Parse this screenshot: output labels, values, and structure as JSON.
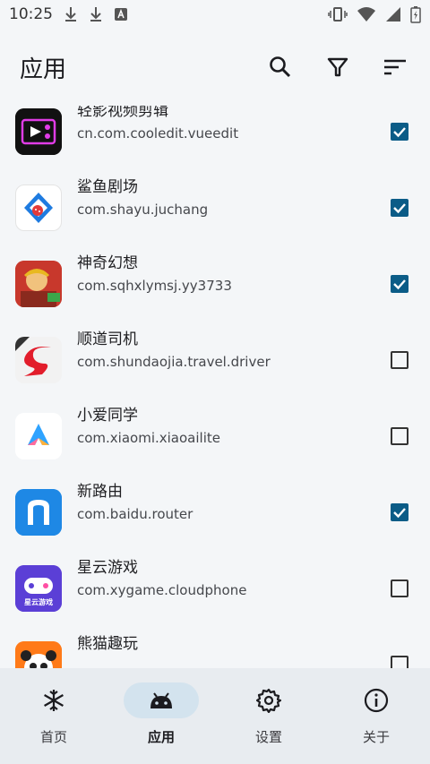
{
  "status": {
    "time": "10:25"
  },
  "appbar": {
    "title": "应用",
    "search_icon": "search-icon",
    "filter_icon": "filter-icon",
    "sort_icon": "sort-icon"
  },
  "apps": [
    {
      "name": "轻影视频剪辑",
      "package": "cn.com.cooledit.vueedit",
      "checked": true
    },
    {
      "name": "鲨鱼剧场",
      "package": "com.shayu.juchang",
      "checked": true
    },
    {
      "name": "神奇幻想",
      "package": "com.sqhxlymsj.yy3733",
      "checked": true
    },
    {
      "name": "顺道司机",
      "package": "com.shundaojia.travel.driver",
      "checked": false
    },
    {
      "name": "小爱同学",
      "package": "com.xiaomi.xiaoailite",
      "checked": false
    },
    {
      "name": "新路由",
      "package": "com.baidu.router",
      "checked": true
    },
    {
      "name": "星云游戏",
      "package": "com.xygame.cloudphone",
      "checked": false
    },
    {
      "name": "熊猫趣玩",
      "package": "",
      "checked": false
    }
  ],
  "icon_text": {
    "star_cloud": "星云游戏"
  },
  "nav": {
    "items": [
      {
        "label": "首页",
        "icon": "snowflake-icon",
        "active": false
      },
      {
        "label": "应用",
        "icon": "android-icon",
        "active": true
      },
      {
        "label": "设置",
        "icon": "gear-icon",
        "active": false
      },
      {
        "label": "关于",
        "icon": "info-icon",
        "active": false
      }
    ]
  },
  "colors": {
    "accent": "#0b5c87",
    "active_pill": "#d3e3ee",
    "nav_bg": "#e8ecf0"
  }
}
